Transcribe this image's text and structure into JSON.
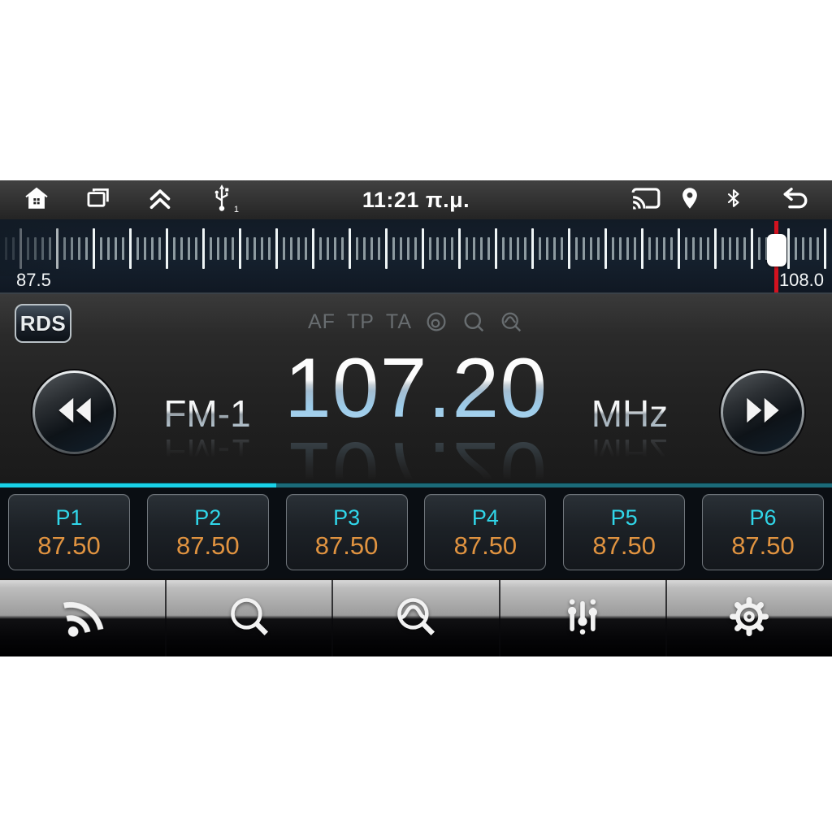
{
  "status_bar": {
    "time": "11:21 π.μ.",
    "usb_badge": "1",
    "left_icons": [
      "home",
      "recent-apps",
      "expand-up",
      "usb"
    ],
    "right_icons": [
      "cast",
      "location",
      "bluetooth",
      "back"
    ]
  },
  "tuner_scale": {
    "min_label": "87.5",
    "max_label": "108.0",
    "indicator_percent": 93.3
  },
  "radio": {
    "rds_label": "RDS",
    "flags": [
      "AF",
      "TP",
      "TA"
    ],
    "status_icons": [
      "loop",
      "search",
      "scan"
    ],
    "band": "FM-1",
    "frequency": "107.20",
    "unit": "MHz"
  },
  "presets": [
    {
      "label": "P1",
      "value": "87.50"
    },
    {
      "label": "P2",
      "value": "87.50"
    },
    {
      "label": "P3",
      "value": "87.50"
    },
    {
      "label": "P4",
      "value": "87.50"
    },
    {
      "label": "P5",
      "value": "87.50"
    },
    {
      "label": "P6",
      "value": "87.50"
    }
  ],
  "toolbar": {
    "items": [
      "rds-broadcast",
      "seek-search",
      "scan",
      "equalizer",
      "settings"
    ]
  },
  "colors": {
    "accent_cyan_bright": "#19d2e8",
    "accent_cyan_dim": "#1b6b79",
    "preset_label_cyan": "#30d6e9",
    "preset_value_orange": "#e09340",
    "indicator_red": "#d2121f",
    "scale_background": "#15202d"
  }
}
